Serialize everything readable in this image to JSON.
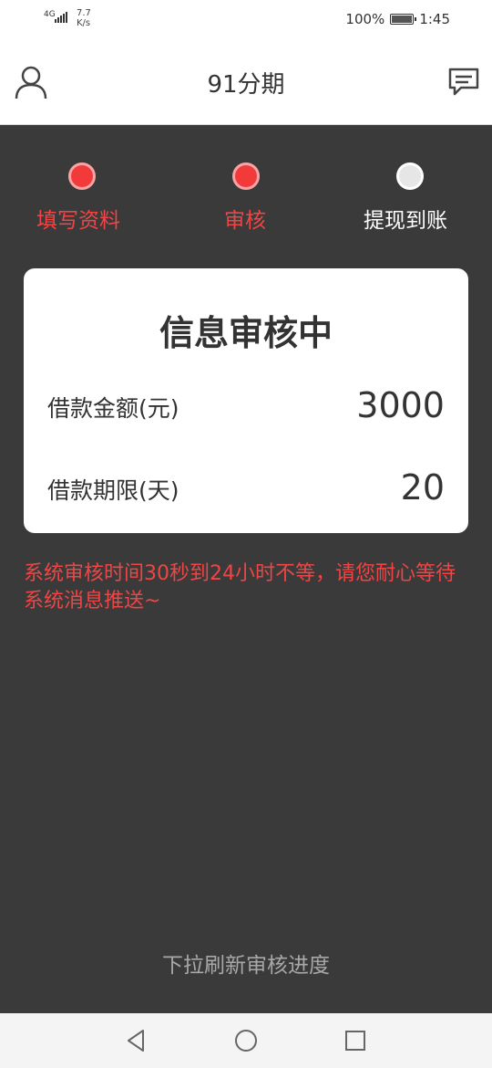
{
  "status_bar": {
    "network": "4G",
    "speed_value": "7.7",
    "speed_unit": "K/s",
    "battery": "100%",
    "time": "1:45"
  },
  "header": {
    "title": "91分期",
    "user_icon": "user-icon",
    "message_icon": "message-icon"
  },
  "steps": [
    {
      "label": "填写资料",
      "state": "done"
    },
    {
      "label": "审核",
      "state": "current"
    },
    {
      "label": "提现到账",
      "state": "pending"
    }
  ],
  "card": {
    "title": "信息审核中",
    "amount_label": "借款金额(元)",
    "amount_value": "3000",
    "term_label": "借款期限(天)",
    "term_value": "20"
  },
  "notice": "系统审核时间30秒到24小时不等，请您耐心等待系统消息推送~",
  "refresh_hint": "下拉刷新审核进度",
  "nav_bar": {
    "back_icon": "back-triangle-icon",
    "home_icon": "home-circle-icon",
    "recents_icon": "recents-square-icon"
  },
  "colors": {
    "accent": "#f23a3a",
    "background": "#3a3a3a",
    "card": "#ffffff"
  }
}
